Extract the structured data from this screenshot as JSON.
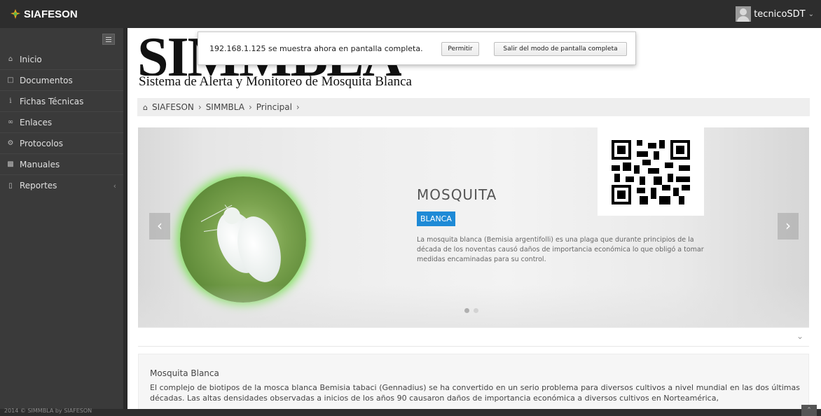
{
  "app": {
    "brand": "SIAFESON",
    "user_name": "tecnicoSDT"
  },
  "sidebar": {
    "items": [
      {
        "label": "Inicio",
        "icon": "home-icon"
      },
      {
        "label": "Documentos",
        "icon": "folder-icon"
      },
      {
        "label": "Fichas Técnicas",
        "icon": "info-icon"
      },
      {
        "label": "Enlaces",
        "icon": "link-icon"
      },
      {
        "label": "Protocolos",
        "icon": "gear-icon"
      },
      {
        "label": "Manuales",
        "icon": "book-icon"
      },
      {
        "label": "Reportes",
        "icon": "document-icon"
      }
    ]
  },
  "header": {
    "logo_text": "SIMMBLA",
    "subtitle": "Sistema de Alerta y Monitoreo de Mosquita Blanca"
  },
  "breadcrumb": {
    "items": [
      "SIAFESON",
      "SIMMBLA",
      "Principal"
    ]
  },
  "carousel": {
    "title": "MOSQUITA",
    "badge": "BLANCA",
    "description": "La mosquita blanca (Bemisia argentifolli) es una plaga que durante principios de la década de los noventas causó daños de importancia económica lo que obligó a tomar medidas encaminadas para su control.",
    "prev_label": "‹",
    "next_label": "›",
    "active_slide": 1,
    "slide_count": 2
  },
  "info": {
    "title": "Mosquita Blanca",
    "text": "El complejo de biotipos de la mosca blanca Bemisia tabaci (Gennadius) se ha convertido en un serio problema para diversos cultivos a nivel mundial en las dos últimas décadas. Las altas densidades observadas a inicios de los años 90 causaron daños de importancia económica a diversos cultivos en Norteamérica,"
  },
  "fullscreen_notice": {
    "message": "192.168.1.125 se muestra ahora en pantalla completa.",
    "allow_label": "Permitir",
    "exit_label": "Salir del modo de pantalla completa"
  },
  "footer": {
    "text": "2014 © SIMMBLA by SIAFESON"
  },
  "colors": {
    "topbar": "#2d2d2d",
    "sidebar": "#3a3a3a",
    "accent": "#1e8ad6"
  }
}
